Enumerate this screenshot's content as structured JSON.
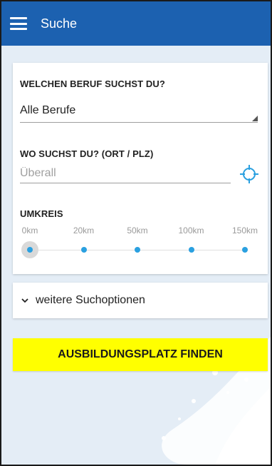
{
  "app_bar": {
    "title": "Suche",
    "menu_icon": "menu-icon"
  },
  "form": {
    "profession": {
      "label": "WELCHEN BERUF SUCHST DU?",
      "selected": "Alle Berufe"
    },
    "location": {
      "label": "WO SUCHST DU? (ORT / PLZ)",
      "value": "",
      "placeholder": "Überall",
      "locate_icon": "crosshair-icon"
    },
    "radius": {
      "label": "UMKREIS",
      "options": [
        "0km",
        "20km",
        "50km",
        "100km",
        "150km"
      ],
      "selected": "0km"
    }
  },
  "more_options": {
    "label": "weitere Suchoptionen",
    "icon": "chevron-down-icon"
  },
  "find_button": {
    "label": "AUSBILDUNGSPLATZ FINDEN"
  },
  "colors": {
    "app_bar": "#1c61b0",
    "accent": "#2aa0e0",
    "button": "#ffff00",
    "background": "#e4edf6"
  }
}
